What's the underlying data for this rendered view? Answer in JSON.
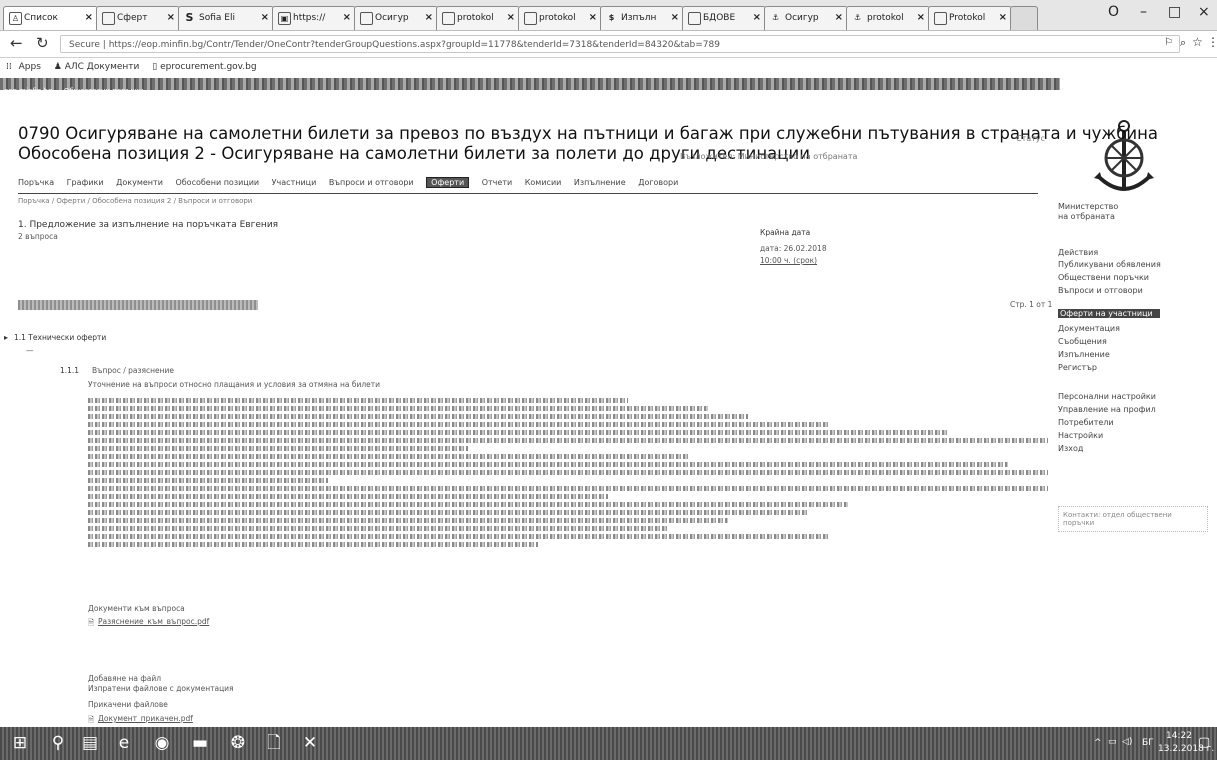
{
  "browser": {
    "tabs": [
      {
        "label": "Список",
        "icon": "person-icon"
      },
      {
        "label": "Сферт",
        "icon": "page-icon"
      },
      {
        "label": "Sofia Eli",
        "icon": "s-icon"
      },
      {
        "label": "https://",
        "icon": "image-icon"
      },
      {
        "label": "Осигур",
        "icon": "page-icon"
      },
      {
        "label": "protokol",
        "icon": "page-icon"
      },
      {
        "label": "protokol",
        "icon": "page-icon"
      },
      {
        "label": "Изпълн",
        "icon": "dollar-icon"
      },
      {
        "label": "БДОВЕ",
        "icon": "page-icon"
      },
      {
        "label": "Осигур",
        "icon": "anchor-icon"
      },
      {
        "label": "protokol",
        "icon": "anchor-icon"
      },
      {
        "label": "Protokol",
        "icon": "page-icon"
      }
    ],
    "url": "Secure | https://eop.minfin.bg/Contr/Tender/OneContr?tenderGroupQuestions.aspx?groupId=11778&tenderId=7318&tenderId=84320&tab=789",
    "bookmarks": [
      "Apps",
      "АЛС Документи",
      "eprocurement.gov.bg"
    ],
    "ribbon_text": "eop.minfin.bg — Обществени поръчки"
  },
  "page": {
    "title_line1": "0790 Осигуряване на самолетни билети за превоз по въздух на пътници и багаж при служебни пътувания в страната и чужбина",
    "title_line2": "Обособена позиция 2 - Осигуряване на самолетни билети за полети до други дестинации",
    "title_aside": "Възложител: Министерство на отбраната",
    "status_label": "Статус",
    "nav": [
      "Поръчка",
      "Графики",
      "Документи",
      "Обособени позиции",
      "Участници",
      "Въпроси и отговори",
      "Оферти",
      "Отчети",
      "Комисии",
      "Изпълнение",
      "Договори"
    ],
    "nav_active": "Оферти",
    "subline": "Поръчка / Оферти / Обособена позиция 2 / Въпроси и отговори",
    "section_heading": "1. Предложение за изпълнение на поръчката Евгения",
    "section_sub": "2 въпроса",
    "right_block_title": "Крайна дата",
    "right_block_values": [
      "дата: 26.02.2018",
      "10:00 ч. (срок)"
    ],
    "page_marker": "Стр. 1 от 1",
    "collapsed_title": "1.1 Технически оферти",
    "collapsed_sub": "—",
    "question_number": "1.1.1",
    "question_title": "Въпрос / разяснение",
    "question_intro": "Уточнение на въпроси относно плащания и условия за отмяна на билети",
    "attachments_title": "Документи към въпроса",
    "attachments_link": "Разяснение_към_въпрос.pdf",
    "footer_heading": "Добавяне на файл",
    "footer_note": "Изпратени файлове с документация",
    "footer_label": "Прикачени файлове",
    "footer_link": "Документ_прикачен.pdf"
  },
  "sidebar": {
    "org_lines": [
      "Министерство",
      "на отбраната"
    ],
    "items": [
      "Действия",
      "Публикувани обявления",
      "Обществени поръчки",
      "Въпроси и отговори",
      "Оферти на участници",
      "Документация",
      "Съобщения",
      "Изпълнение",
      "Регистър",
      "Персонални настройки",
      "Управление на профил",
      "Потребители",
      "Настройки",
      "Изход"
    ],
    "active_item": "Оферти на участници",
    "side_note": "Контакти: отдел обществени поръчки"
  },
  "taskbar": {
    "lang": "БГ",
    "time": "14:22",
    "date": "13.2.2018 г."
  }
}
